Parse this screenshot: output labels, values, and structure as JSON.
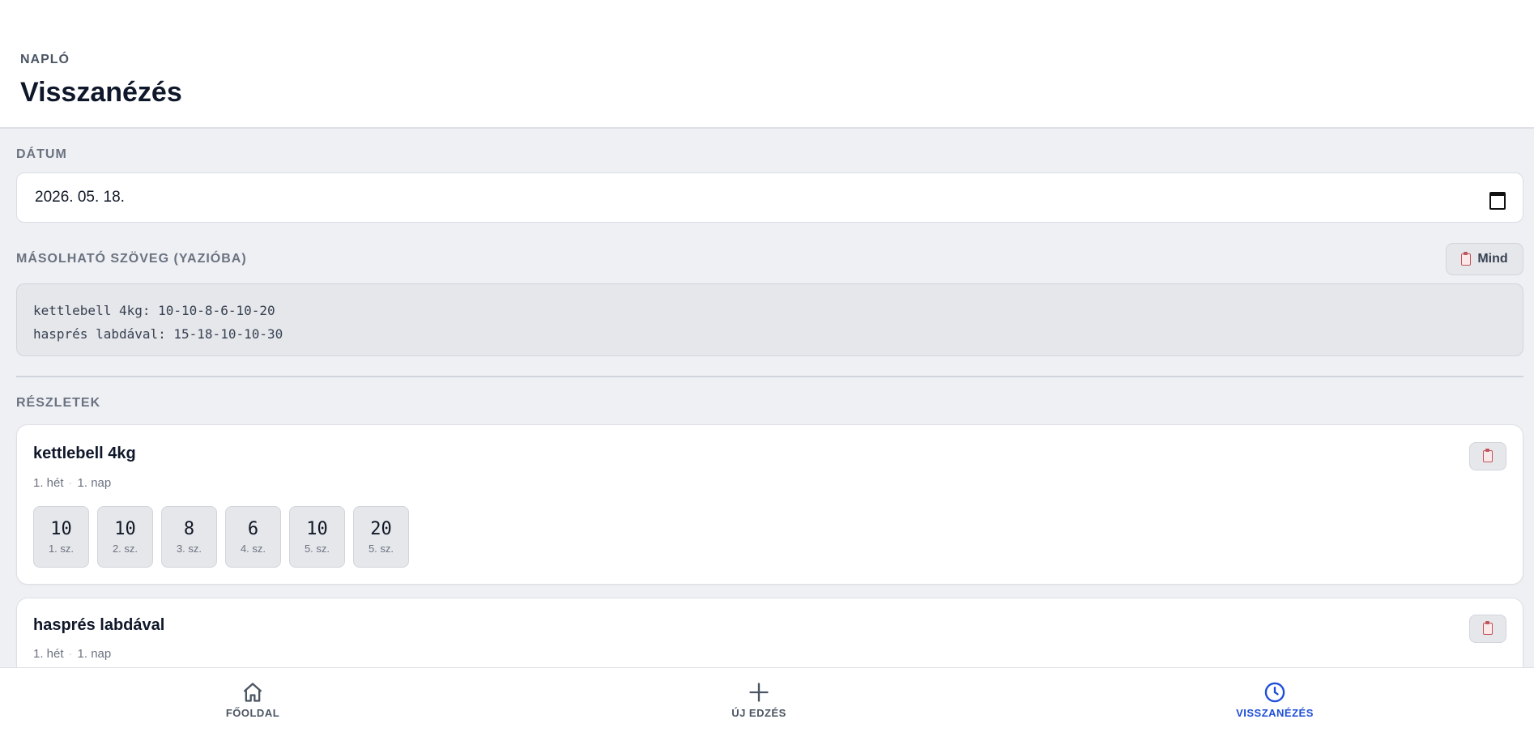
{
  "header": {
    "eyebrow": "NAPLÓ",
    "title": "Visszanézés"
  },
  "date": {
    "label": "DÁTUM",
    "value": "2026. 05. 18.",
    "icon": "calendar-icon"
  },
  "copy_section": {
    "label": "MÁSOLHATÓ SZÖVEG (YAZIÓBA)",
    "button_label": "Mind",
    "lines": [
      "kettlebell 4kg: 10-10-8-6-10-20",
      "hasprés labdával: 15-18-10-10-30"
    ]
  },
  "details": {
    "label": "RÉSZLETEK",
    "exercises": [
      {
        "name": "kettlebell 4kg",
        "week": "1. hét",
        "day": "1. nap",
        "sets": [
          {
            "value": "10",
            "label": "1. sz."
          },
          {
            "value": "10",
            "label": "2. sz."
          },
          {
            "value": "8",
            "label": "3. sz."
          },
          {
            "value": "6",
            "label": "4. sz."
          },
          {
            "value": "10",
            "label": "5. sz."
          },
          {
            "value": "20",
            "label": "5. sz."
          }
        ]
      },
      {
        "name": "hasprés labdával",
        "week": "1. hét",
        "day": "1. nap"
      }
    ]
  },
  "nav": {
    "items": [
      {
        "label": "FŐOLDAL",
        "icon": "home-icon"
      },
      {
        "label": "ÚJ EDZÉS",
        "icon": "plus-icon"
      },
      {
        "label": "VISSZANÉZÉS",
        "icon": "clock-icon",
        "active": true
      }
    ],
    "active_color": "#1d4ed8"
  }
}
